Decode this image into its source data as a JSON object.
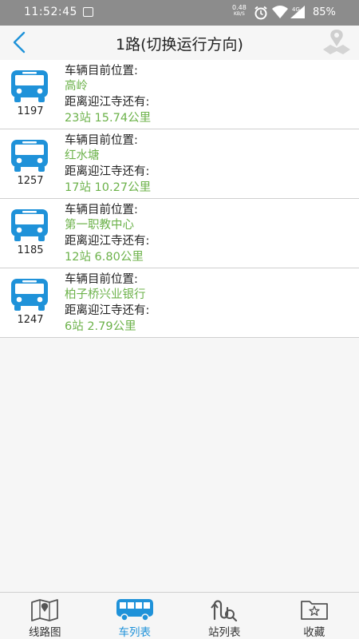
{
  "status_bar": {
    "time": "11:52:45",
    "net_speed_value": "0.48",
    "net_speed_unit": "KB/S",
    "battery": "85%"
  },
  "nav": {
    "title": "1路(切换运行方向)",
    "back_icon": "back-arrow-icon",
    "map_icon": "map-pin-icon"
  },
  "colors": {
    "accent": "#1f92d9",
    "green_text": "#6cb24a",
    "status_bar": "#8c8c8c"
  },
  "labels": {
    "position_label": "车辆目前位置:",
    "distance_label": "距离迎江寺还有:"
  },
  "vehicles": [
    {
      "bus_no": "1197",
      "location": "高岭",
      "remaining": "23站  15.74公里"
    },
    {
      "bus_no": "1257",
      "location": "红水塘",
      "remaining": "17站  10.27公里"
    },
    {
      "bus_no": "1185",
      "location": "第一职教中心",
      "remaining": "12站  6.80公里"
    },
    {
      "bus_no": "1247",
      "location": "柏子桥兴业银行",
      "remaining": "6站  2.79公里"
    }
  ],
  "tabs": [
    {
      "label": "线路图",
      "icon": "route-map-icon",
      "active": false
    },
    {
      "label": "车列表",
      "icon": "bus-icon",
      "active": true
    },
    {
      "label": "站列表",
      "icon": "station-search-icon",
      "active": false
    },
    {
      "label": "收藏",
      "icon": "favorite-folder-icon",
      "active": false
    }
  ]
}
